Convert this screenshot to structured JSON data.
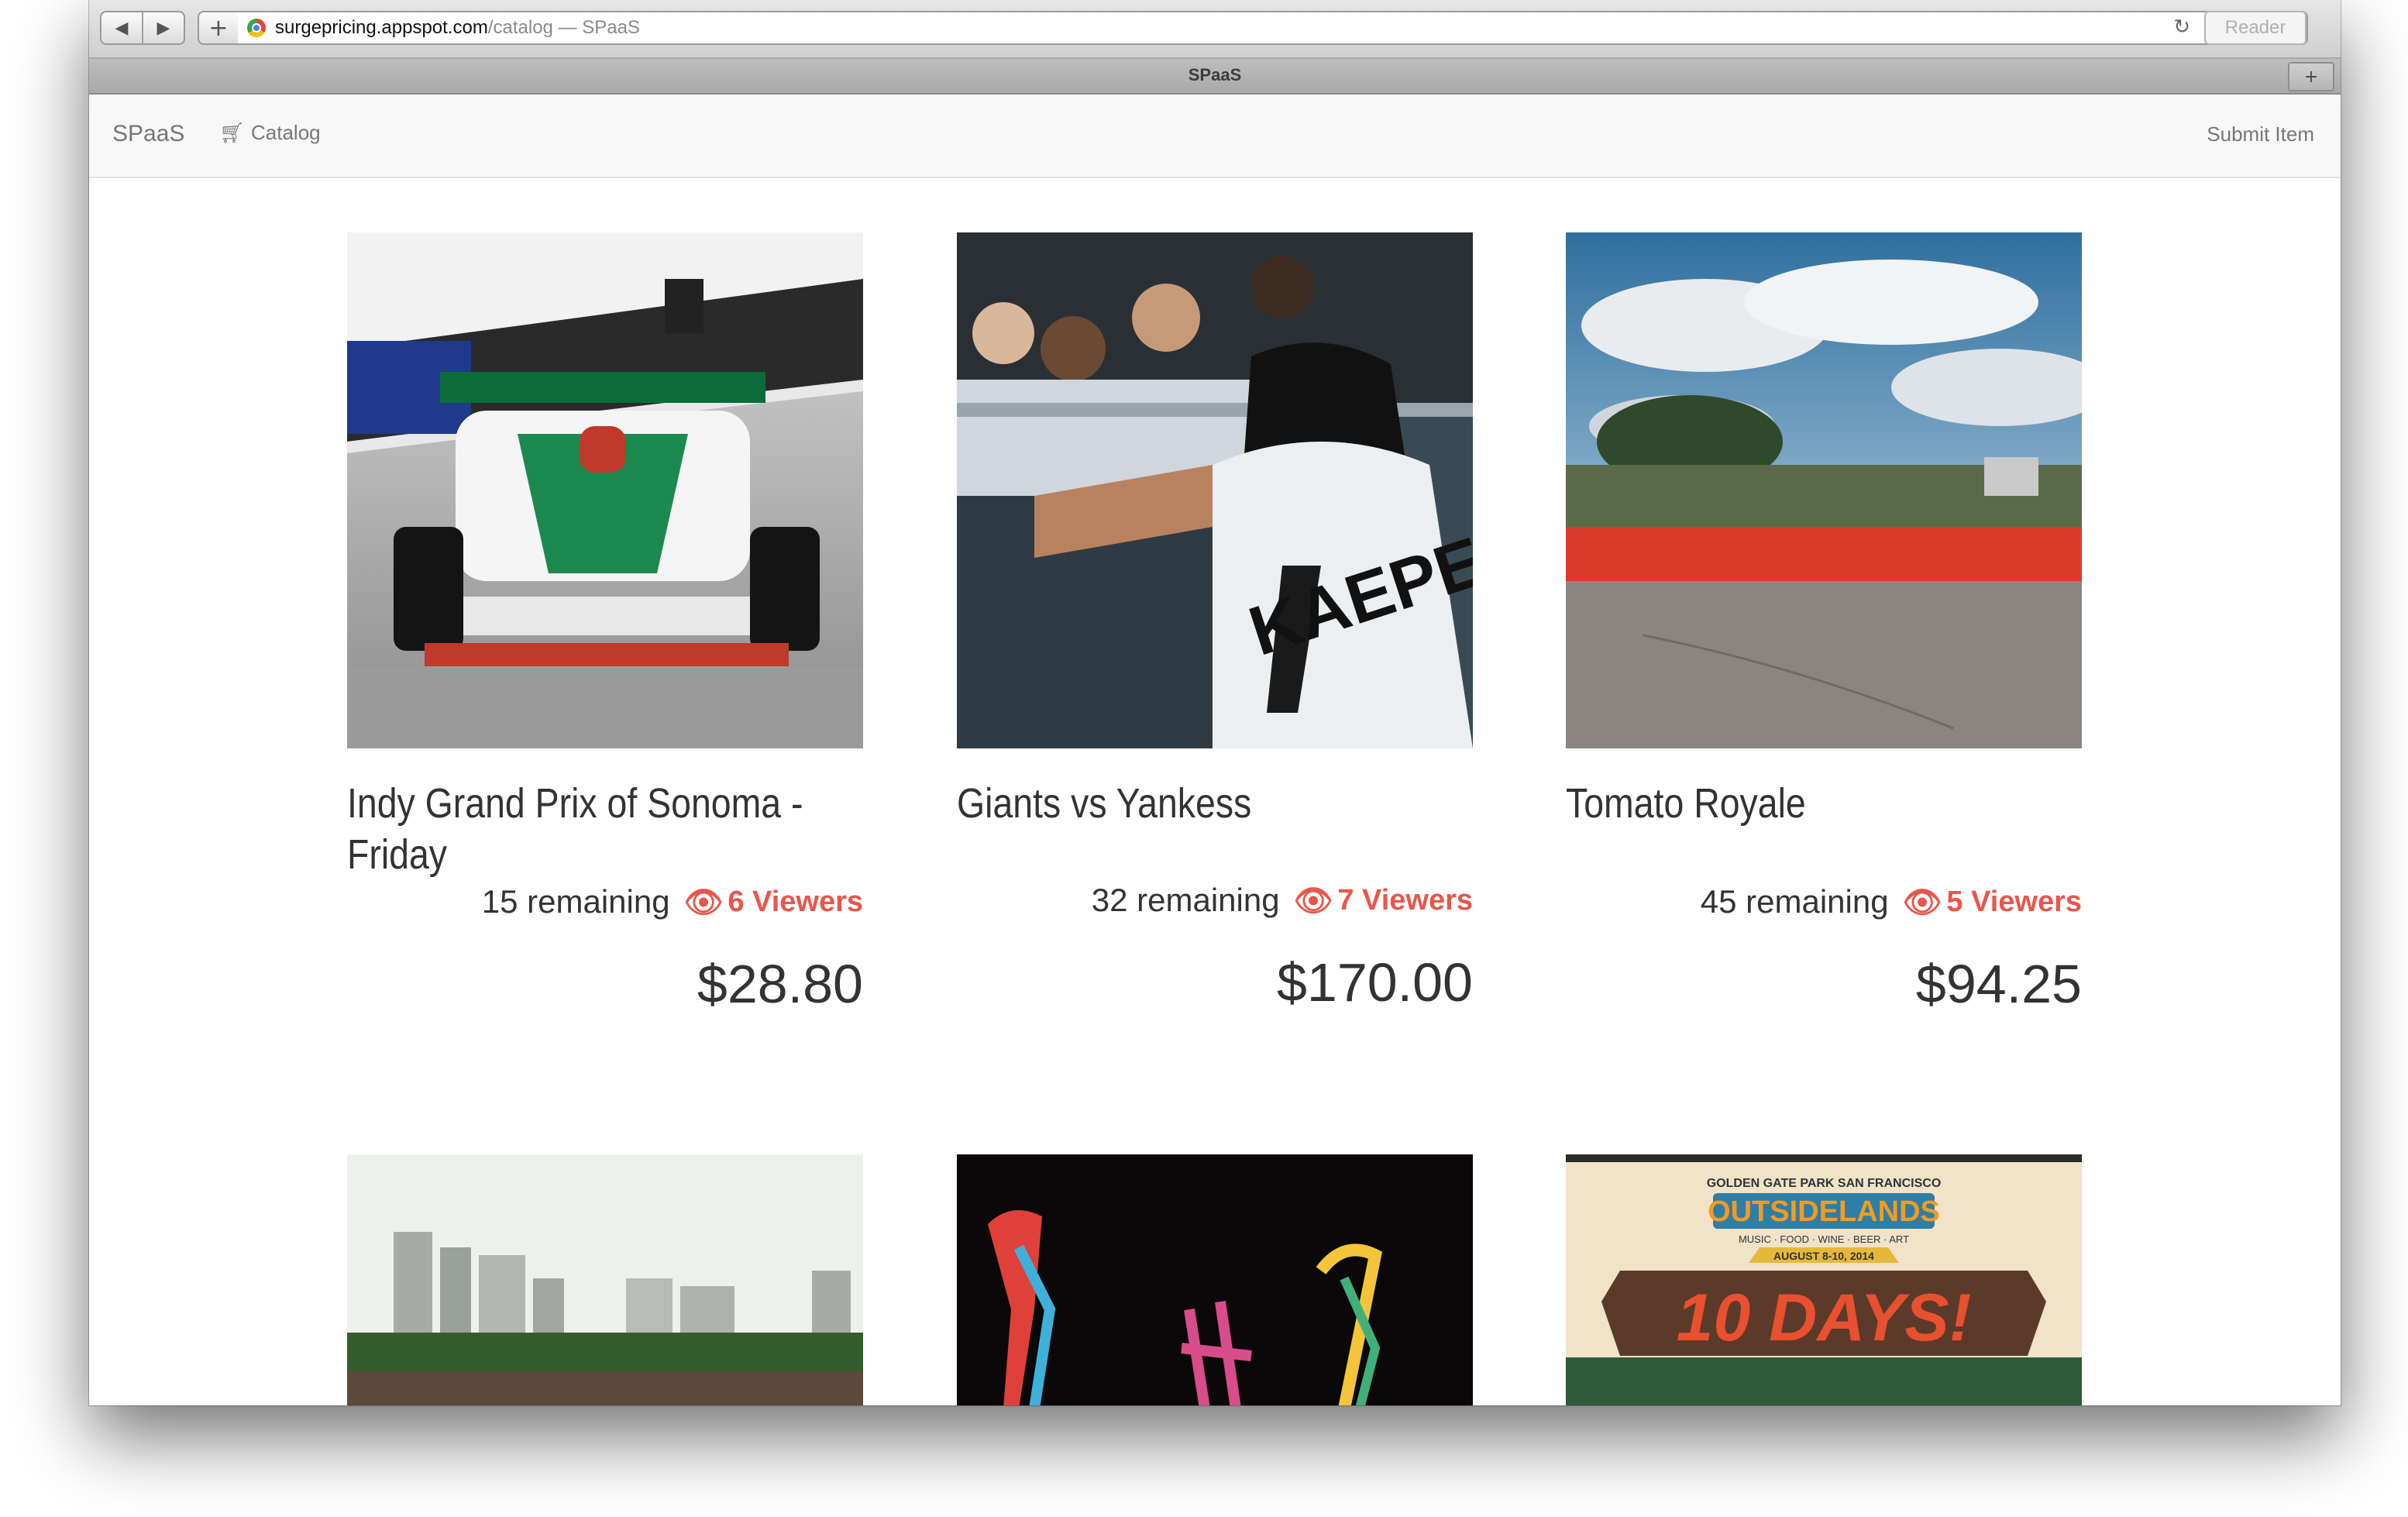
{
  "browser": {
    "url_host": "surgepricing.appspot.com",
    "url_rest": "/catalog — SPaaS",
    "reader_label": "Reader",
    "tab_title": "SPaaS"
  },
  "navbar": {
    "brand": "SPaaS",
    "catalog_label": "Catalog",
    "submit_label": "Submit Item"
  },
  "catalog": {
    "items": [
      {
        "title": "Indy Grand Prix of Sonoma - Friday",
        "remaining": "15 remaining",
        "viewers": "6 Viewers",
        "price": "$28.80"
      },
      {
        "title": "Giants vs Yankess",
        "remaining": "32 remaining",
        "viewers": "7 Viewers",
        "price": "$170.00"
      },
      {
        "title": "Tomato Royale",
        "remaining": "45 remaining",
        "viewers": "5 Viewers",
        "price": "$94.25"
      }
    ],
    "poster": {
      "header": "GOLDEN GATE PARK  SAN FRANCISCO",
      "logo": "OUTSIDELANDS",
      "tagline": "MUSIC · FOOD · WINE · BEER · ART",
      "dates": "AUGUST 8-10, 2014",
      "banner": "10 DAYS!"
    }
  },
  "colors": {
    "viewer_accent": "#e9564b",
    "navbar_bg": "#f8f8f8"
  }
}
